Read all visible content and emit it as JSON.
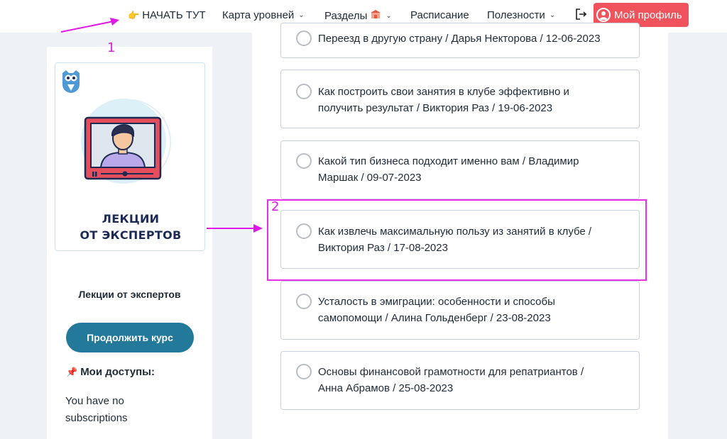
{
  "nav": {
    "start_label": "НАЧАТЬ ТУТ",
    "levels_label": "Карта уровней",
    "sections_label": "Разделы",
    "schedule_label": "Расписание",
    "useful_label": "Полезности",
    "profile_label": "Мой профиль"
  },
  "sidebar": {
    "card_title_line1": "ЛЕКЦИИ",
    "card_title_line2": "ОТ ЭКСПЕРТОВ",
    "course_title": "Лекции от экспертов",
    "continue_label": "Продолжить курс",
    "access_title": "Мои доступы:",
    "no_subscriptions": "You have no subscriptions"
  },
  "lessons": [
    {
      "line1": "Переезд в другую страну / Дарья Некторова / 12-06-2023",
      "line2": ""
    },
    {
      "line1": "Как построить свои занятия в клубе эффективно и",
      "line2": "получить результат / Виктория Раз / 19-06-2023"
    },
    {
      "line1": "Какой тип бизнеса подходит именно вам / Владимир",
      "line2": "Маршак / 09-07-2023"
    },
    {
      "line1": "Как извлечь максимальную пользу из занятий в клубе /",
      "line2": "Виктория Раз / 17-08-2023"
    },
    {
      "line1": "Усталость в эмиграции: особенности и способы",
      "line2": "самопомощи / Алина Гольденберг / 23-08-2023"
    },
    {
      "line1": "Основы финансовой грамотности для репатриантов /",
      "line2": "Анна Абрамов / 25-08-2023"
    }
  ],
  "annotations": {
    "label_1": "1",
    "label_2": "2",
    "color": "#e018e6"
  },
  "colors": {
    "profile_button": "#f0535b",
    "continue_button": "#22799a",
    "card_title": "#1c2a54"
  }
}
